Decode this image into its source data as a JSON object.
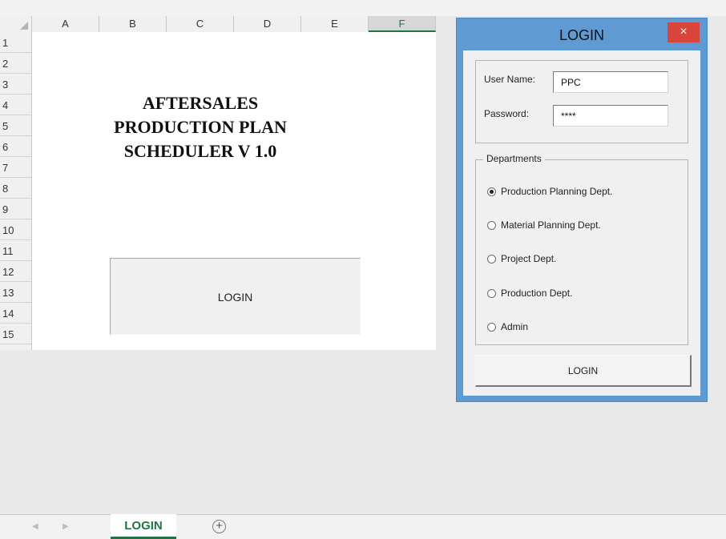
{
  "spreadsheet": {
    "columns": [
      "A",
      "B",
      "C",
      "D",
      "E",
      "F"
    ],
    "selected_column": "F",
    "rows": [
      "1",
      "2",
      "3",
      "4",
      "5",
      "6",
      "7",
      "8",
      "9",
      "10",
      "11",
      "12",
      "13",
      "14",
      "15"
    ],
    "title_lines": [
      "AFTERSALES",
      "PRODUCTION PLAN",
      "SCHEDULER V 1.0"
    ],
    "login_button_label": "LOGIN"
  },
  "dialog": {
    "title": "LOGIN",
    "close_symbol": "×",
    "username_label": "User Name:",
    "username_value": "PPC",
    "password_label": "Password:",
    "password_value": "****",
    "departments_label": "Departments",
    "departments": [
      {
        "label": "Production Planning Dept.",
        "selected": true
      },
      {
        "label": "Material Planning Dept.",
        "selected": false
      },
      {
        "label": "Project Dept.",
        "selected": false
      },
      {
        "label": "Production Dept.",
        "selected": false
      },
      {
        "label": "Admin",
        "selected": false
      }
    ],
    "login_button_label": "LOGIN"
  },
  "tabs": {
    "sheets": [
      "LOGIN"
    ],
    "active_sheet": "LOGIN",
    "add_symbol": "+",
    "prev_icon": "caret-left-icon",
    "next_icon": "caret-right-icon"
  },
  "colors": {
    "excel_green": "#217346",
    "dialog_frame": "#5f9ad3",
    "close_button": "#d9453a"
  }
}
